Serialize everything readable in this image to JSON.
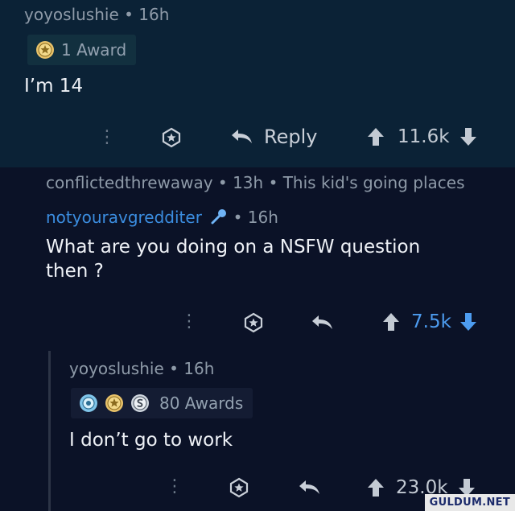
{
  "comment1": {
    "username": "yoyoslushie",
    "time": "16h",
    "award_count": "1 Award",
    "body": "I’m 14",
    "reply_label": "Reply",
    "score": "11.6k"
  },
  "comment2": {
    "parent_meta": "conflictedthrewaway • 13h • This kid's going places",
    "username": "notyouravgredditer",
    "time": "16h",
    "body_line1": "What are you doing on a NSFW question",
    "body_line2": "then ?",
    "score": "7.5k"
  },
  "comment3": {
    "username": "yoyoslushie",
    "time": "16h",
    "award_count": "80 Awards",
    "body": "I don’t go to work",
    "score": "23.0k"
  },
  "watermark": "GULDUM.NET",
  "colors": {
    "accent_blue": "#4d9cf0",
    "background_top": "#0b2236",
    "background_bottom": "#0b1227"
  }
}
